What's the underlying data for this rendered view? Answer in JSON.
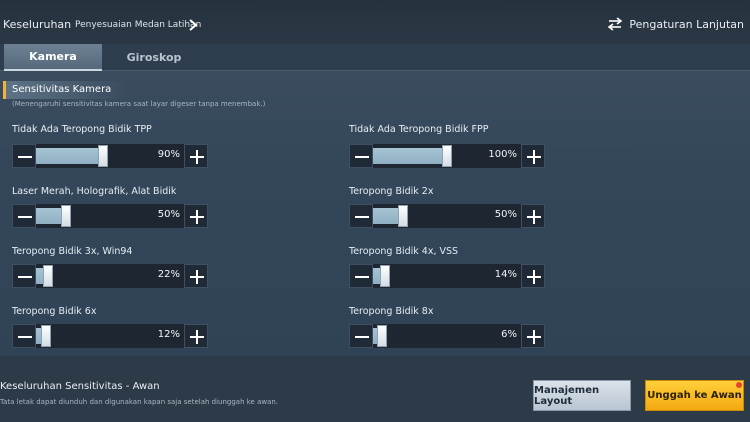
{
  "header": {
    "root_label": "Keseluruhan",
    "sub_label": "Penyesuaian Medan Latihan",
    "advanced_label": "Pengaturan Lanjutan"
  },
  "tabs": [
    {
      "label": "Kamera",
      "active": true
    },
    {
      "label": "Giroskop",
      "active": false
    }
  ],
  "section": {
    "title": "Sensitivitas Kamera",
    "subtitle": "(Menengaruhi sensitivitas kamera saat layar digeser tanpa menembak.)"
  },
  "sliders": [
    {
      "label": "Tidak Ada Teropong Bidik TPP",
      "value": "90%",
      "level": 0.45
    },
    {
      "label": "Tidak Ada Teropong Bidik FPP",
      "value": "100%",
      "level": 0.5
    },
    {
      "label": "Laser Merah, Holografik, Alat Bidik",
      "value": "50%",
      "level": 0.2
    },
    {
      "label": "Teropong Bidik 2x",
      "value": "50%",
      "level": 0.2
    },
    {
      "label": "Teropong Bidik 3x, Win94",
      "value": "22%",
      "level": 0.08
    },
    {
      "label": "Teropong Bidik 4x, VSS",
      "value": "14%",
      "level": 0.08
    },
    {
      "label": "Teropong Bidik 6x",
      "value": "12%",
      "level": 0.07
    },
    {
      "label": "Teropong Bidik 8x",
      "value": "6%",
      "level": 0.06
    }
  ],
  "footer": {
    "title": "Keseluruhan Sensitivitas - Awan",
    "subtitle": "Tata letak dapat diunduh dan digunakan kapan saja setelah diunggah ke awan.",
    "layout_button": "Manajemen Layout",
    "upload_button": "Unggah ke Awan"
  }
}
